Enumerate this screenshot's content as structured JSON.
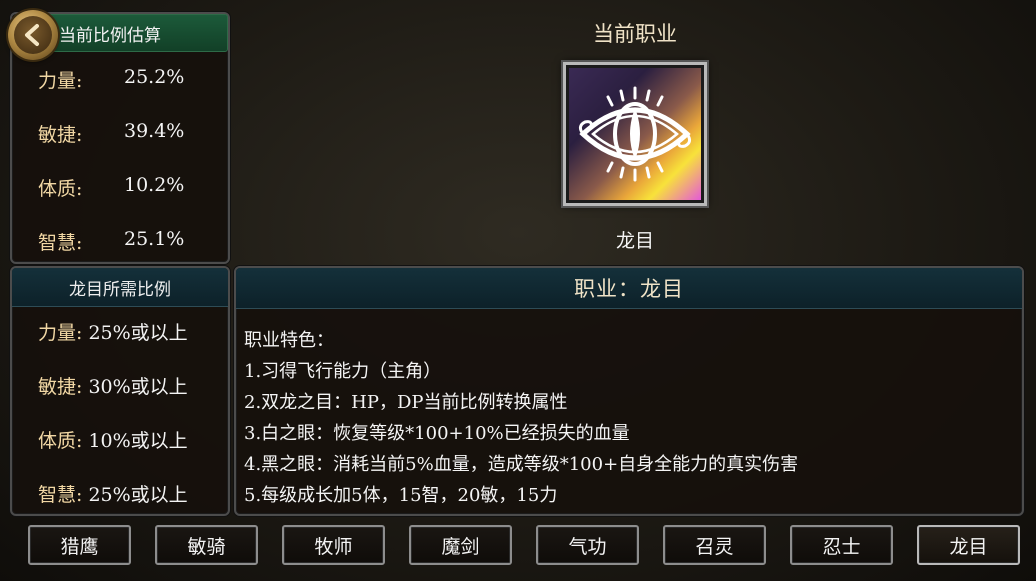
{
  "back_button": {
    "icon": "chevron-left-icon"
  },
  "ratio_panel": {
    "title": "当前比例估算",
    "stats": [
      {
        "label": "力量:",
        "value": "25.2%"
      },
      {
        "label": "敏捷:",
        "value": "39.4%"
      },
      {
        "label": "体质:",
        "value": "10.2%"
      },
      {
        "label": "智慧:",
        "value": "25.1%"
      }
    ]
  },
  "requirement_panel": {
    "title": "龙目所需比例",
    "stats": [
      {
        "label": "力量:",
        "value": "25%或以上"
      },
      {
        "label": "敏捷:",
        "value": "30%或以上"
      },
      {
        "label": "体质:",
        "value": "10%或以上"
      },
      {
        "label": "智慧:",
        "value": "25%或以上"
      }
    ]
  },
  "current_class": {
    "title": "当前职业",
    "name": "龙目",
    "emblem_icon": "dragon-eye-icon"
  },
  "class_detail": {
    "header": "职业：龙目",
    "lines": [
      "职业特色：",
      "1.习得飞行能力（主角）",
      "2.双龙之目：HP，DP当前比例转换属性",
      "3.白之眼：恢复等级*100+10%已经损失的血量",
      "4.黑之眼：消耗当前5%血量，造成等级*100+自身全能力的真实伤害",
      "5.每级成长加5体，15智，20敏，15力"
    ]
  },
  "class_tabs": [
    "猎鹰",
    "敏骑",
    "牧师",
    "魔剑",
    "气功",
    "召灵",
    "忍士",
    "龙目"
  ],
  "colors": {
    "accent_gold": "#f0e3c7",
    "label_gold": "#f1d7a4",
    "header_teal": "#14303a",
    "header_green": "#1c5a3a"
  }
}
